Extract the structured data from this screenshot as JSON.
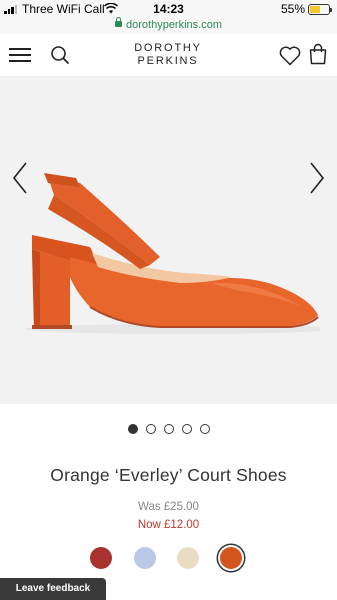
{
  "status_bar": {
    "carrier": "Three WiFi Call",
    "time": "14:23",
    "battery_percent_label": "55%",
    "battery_level": 0.55
  },
  "browser": {
    "url": "dorothyperkins.com"
  },
  "header": {
    "brand_line1": "DOROTHY",
    "brand_line2": "PERKINS",
    "icons": [
      "menu-icon",
      "search-icon",
      "wishlist-heart-icon",
      "shopping-bag-icon"
    ]
  },
  "gallery": {
    "image_subject": "orange-slingback-block-heel-shoe",
    "current_index": 1,
    "total_images": 5,
    "icons": [
      "chevron-left-icon",
      "chevron-right-icon"
    ]
  },
  "product": {
    "title": "Orange ‘Everley’ Court Shoes",
    "price_was": "Was £25.00",
    "price_now": "Now £12.00",
    "swatches": [
      {
        "color": "#a8322e",
        "selected": false
      },
      {
        "color": "#b9c8e6",
        "selected": false
      },
      {
        "color": "#e8dcc2",
        "selected": false
      },
      {
        "color": "#d2551e",
        "selected": true
      }
    ]
  },
  "feedback": {
    "label": "Leave feedback"
  },
  "colors": {
    "accent_sale": "#c0392b",
    "product_orange": "#e8652b",
    "gallery_bg": "#f2f2f2",
    "url_green": "#2e8b57"
  }
}
